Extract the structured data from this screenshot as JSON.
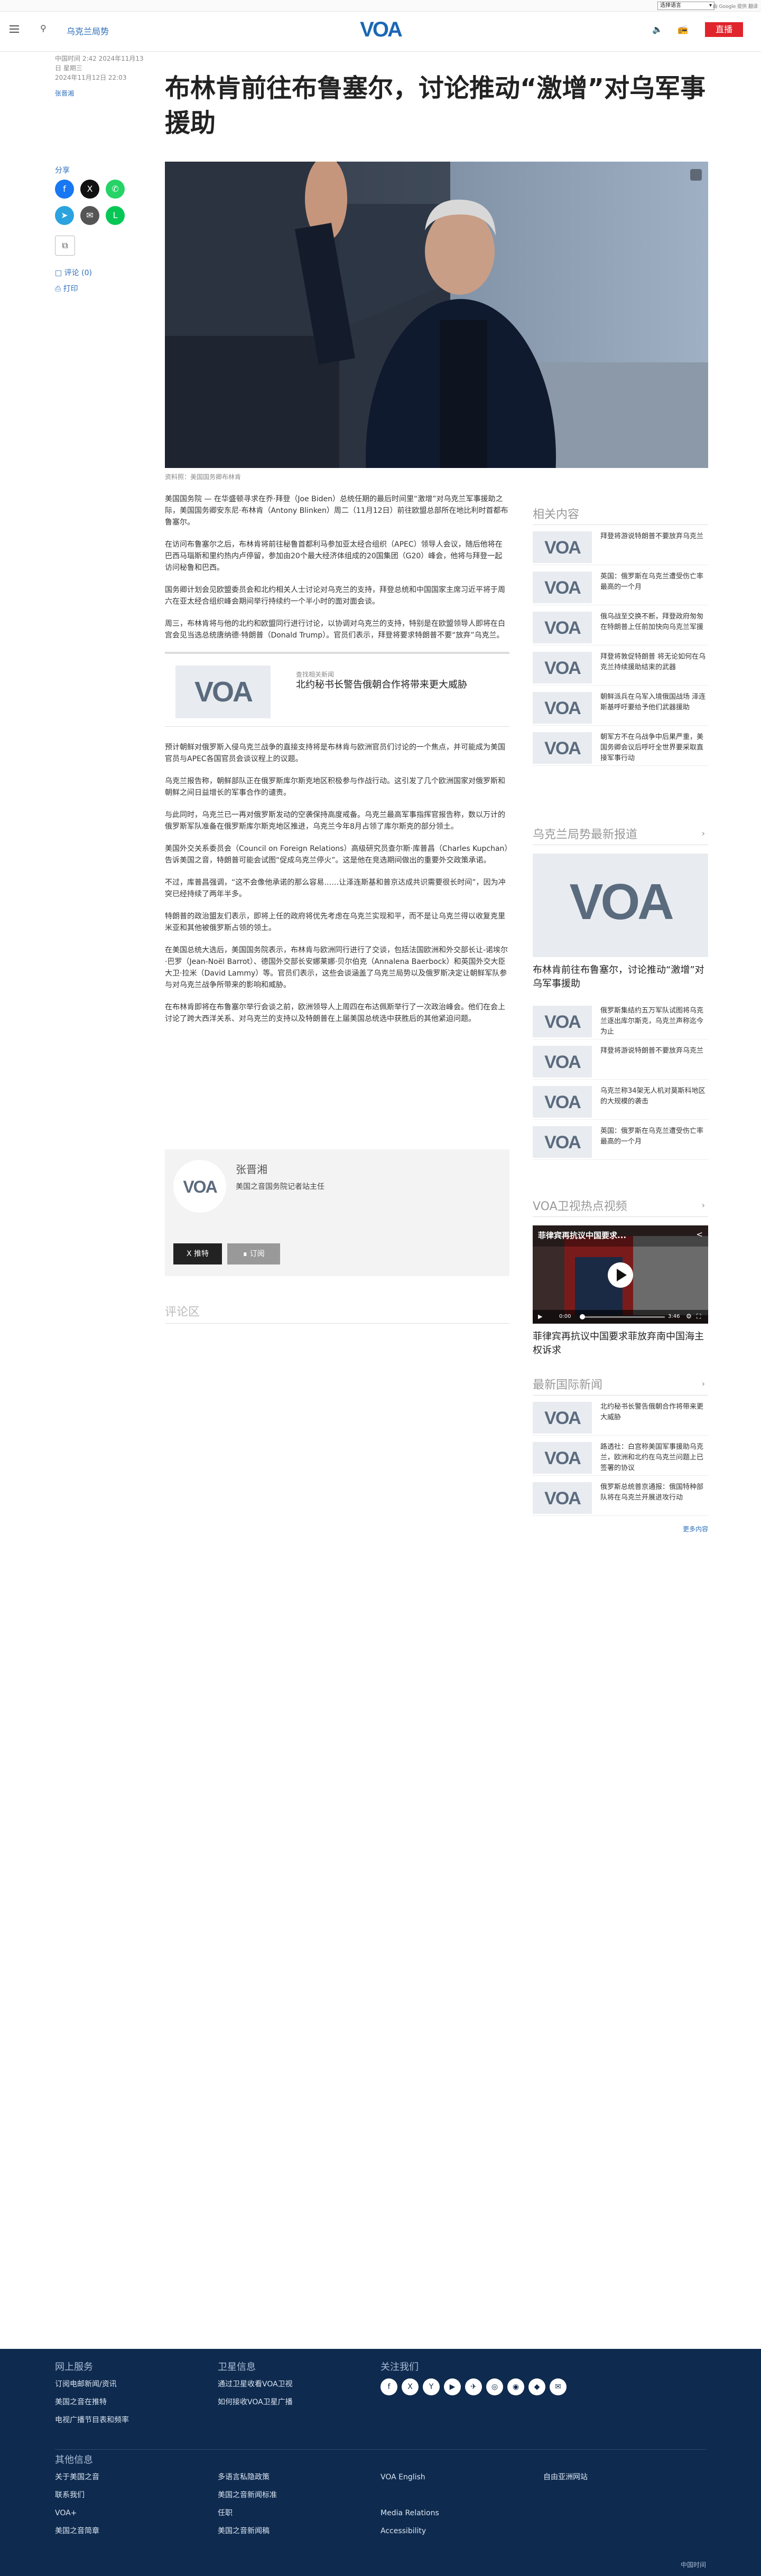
{
  "translate_bar": {
    "select_label": "选择语言",
    "powered": "由 Google 提供 翻译"
  },
  "header": {
    "section": "乌克兰局势",
    "logo": "VOA",
    "live": "直播"
  },
  "meta": {
    "date": "中国时间 2:42 2024年11月13日 星期三",
    "updated": "2024年11月12日 22:03",
    "author": "张晋湘"
  },
  "article": {
    "title": "布林肯前往布鲁塞尔，讨论推动“激增”对乌军事援助",
    "caption": "资料照：美国国务卿布林肯",
    "paragraphs": [
      "美国国务院 — 在华盛顿寻求在乔·拜登（Joe Biden）总统任期的最后时间里“激增”对乌克兰军事援助之际，美国国务卿安东尼·布林肯（Antony Blinken）周二（11月12日）前往欧盟总部所在地比利时首都布鲁塞尔。",
      "在访问布鲁塞尔之后，布林肯将前往秘鲁首都利马参加亚太经合组织（APEC）领导人会议，随后他将在巴西马瑙斯和里约热内卢停留，参加由20个最大经济体组成的20国集团（G20）峰会，他将与拜登一起访问秘鲁和巴西。",
      "国务卿计划会见欧盟委员会和北约相关人士讨论对乌克兰的支持，拜登总统和中国国家主席习近平将于周六在亚太经合组织峰会期间举行持续约一个半小时的面对面会谈。",
      "周三，布林肯将与他的北约和欧盟同行进行讨论，以协调对乌克兰的支持，特别是在欧盟领导人即将在白宫会见当选总统唐纳德·特朗普（Donald Trump）。官员们表示，拜登将要求特朗普不要“放弃”乌克兰。"
    ],
    "related": {
      "label": "查找相关新闻",
      "title": "北约秘书长警告俄朝合作将带来更大威胁"
    },
    "paragraphs2": [
      "预计朝鲜对俄罗斯入侵乌克兰战争的直接支持将是布林肯与欧洲官员们讨论的一个焦点，并可能成为美国官员与APEC各国官员会谈议程上的议题。",
      "乌克兰报告称，朝鲜部队正在俄罗斯库尔斯克地区积极参与作战行动。这引发了几个欧洲国家对俄罗斯和朝鲜之间日益增长的军事合作的谴责。",
      "与此同时，乌克兰已一再对俄罗斯发动的空袭保持高度戒备。乌克兰最高军事指挥官报告称，数以万计的俄罗斯军队准备在俄罗斯库尔斯克地区推进，乌克兰今年8月占领了库尔斯克的部分领土。",
      "美国外交关系委员会（Council on Foreign Relations）高级研究员查尔斯·库普昌（Charles Kupchan）告诉美国之音，特朗普可能会试图“促成乌克兰停火”。这是他在竞选期间做出的重要外交政策承诺。",
      "不过，库普昌强调，“这不会像他承诺的那么容易……让泽连斯基和普京达成共识需要很长时间”，因为冲突已经持续了两年半多。",
      "特朗普的政治盟友们表示，即将上任的政府将优先考虑在乌克兰实现和平，而不是让乌克兰得以收复克里米亚和其他被俄罗斯占领的领土。",
      "在美国总统大选后，美国国务院表示，布林肯与欧洲同行进行了交谈，包括法国欧洲和外交部长让-诺埃尔·巴罗（Jean-Noël Barrot）、德国外交部长安娜莱娜·贝尔伯克（Annalena Baerbock）和英国外交大臣大卫·拉米（David Lammy）等。官员们表示，这些会谈涵盖了乌克兰局势以及俄罗斯决定让朝鲜军队参与对乌克兰战争所带来的影响和威胁。",
      "在布林肯即将在布鲁塞尔举行会谈之前，欧洲领导人上周四在布达佩斯举行了一次政治峰会。他们在会上讨论了跨大西洋关系、对乌克兰的支持以及特朗普在上届美国总统选中获胜后的其他紧迫问题。"
    ],
    "author_name": "张晋湘",
    "author_desc": "美国之音国务院记者站主任",
    "follow": "推特",
    "subscribe": "订阅",
    "comments": "评论区"
  },
  "share": {
    "label": "分享",
    "comments_link": "评论 (0)",
    "print_link": "打印"
  },
  "sidebar": {
    "related_title": "相关内容",
    "related": [
      "拜登将游说特朗普不要放弃乌克兰",
      "英国：俄罗斯在乌克兰遭受伤亡率最高的一个月",
      "俄乌战至交换不断，拜登政府匆匆在特朗普上任前加快向乌克兰军援",
      "拜登将敦促特朗普 将无论如何在乌克兰持续援助结束的武器",
      "朝鲜派兵在乌军入境俄国战场 泽连斯基呼吁要给予他们武器援助",
      "朝军方不在乌战争中后果严重，美国务卿会议后呼吁全世界要采取直接军事行动"
    ],
    "ukraine_title": "乌克兰局势最新报道",
    "ukraine_big": "布林肯前往布鲁塞尔，讨论推动“激增”对乌军事援助",
    "ukraine": [
      "俄罗斯集结约五万军队试图将乌克兰逐出库尔斯克，乌克兰声称迄今为止",
      "拜登将游说特朗普不要放弃乌克兰",
      "乌克兰称34架无人机对莫斯科地区的大规模的袭击",
      "英国：俄罗斯在乌克兰遭受伤亡率最高的一个月"
    ],
    "video_title": "VOA卫视热点视频",
    "video_caption": "菲律宾再抗议中国要求菲放弃南中国海主权诉求",
    "video_overlay": "菲律宾再抗议中国要求...",
    "video_time": "0:00",
    "video_duration": "3:46",
    "intl_title": "最新国际新闻",
    "intl": [
      "北约秘书长警告俄朝合作将带来更大威胁",
      "路透社：白宫称美国军事援助乌克兰，欧洲和北约在乌克兰问题上已签署的协议",
      "俄罗斯总统普京通报：俄国特种部队将在乌克兰开展进攻行动"
    ],
    "more": "更多内容"
  },
  "footer": {
    "col1_title": "网上服务",
    "col1": [
      "订阅电邮新闻/资讯",
      "美国之音在推特",
      "电视广播节目表和频率"
    ],
    "col2_title": "卫星信息",
    "col2": [
      "通过卫星收看VOA卫视",
      "如何接收VOA卫星广播"
    ],
    "col3_title": "关注我们",
    "social": [
      "f",
      "X",
      "Y",
      "▶",
      "✈",
      "◎",
      "◉",
      "◆",
      "✉"
    ],
    "other_title": "其他信息",
    "o1": [
      "关于美国之音",
      "联系我们",
      "VOA+",
      "美国之音简章"
    ],
    "o2": [
      "多语言私隐政策",
      "美国之音新闻标准",
      "任职",
      "美国之音新闻稿"
    ],
    "o3": [
      "VOA English",
      "",
      "Media Relations",
      "Accessibility"
    ],
    "o4": [
      "自由亚洲网站",
      "",
      "",
      ""
    ],
    "copyright": "中国时间"
  },
  "colors": {
    "brand": "#1a67b5",
    "live": "#e0242c",
    "footer": "#0e2a4e"
  }
}
